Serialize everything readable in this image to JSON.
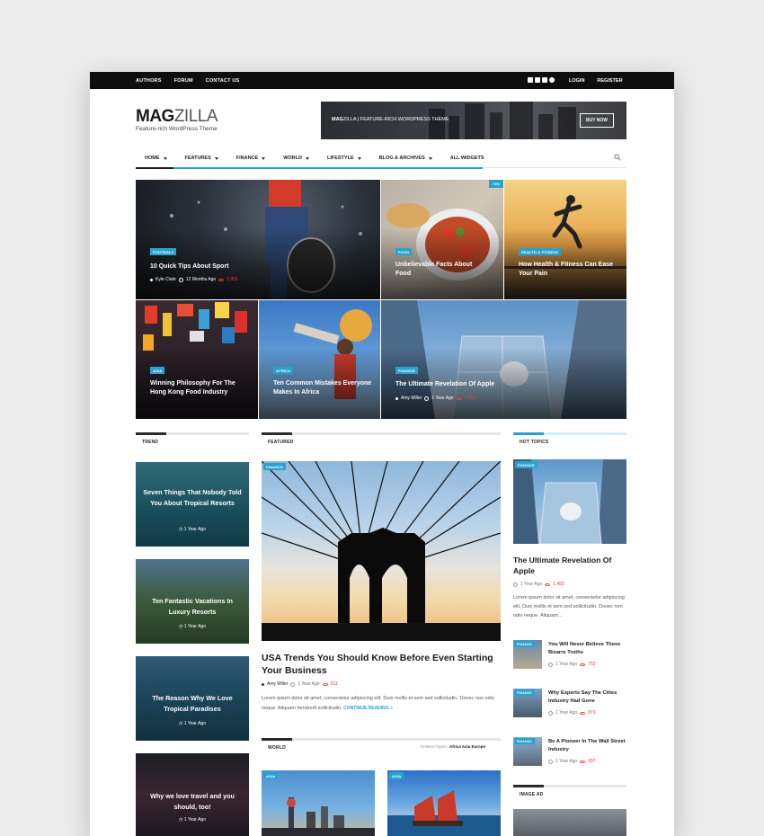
{
  "topbar": {
    "links": [
      "AUTHORS",
      "FORUM",
      "CONTACT US"
    ],
    "social_icons": [
      "rss-icon",
      "facebook-icon",
      "twitter-icon",
      "pinterest-icon"
    ],
    "login": "LOGIN",
    "register": "REGISTER"
  },
  "logo": {
    "mag": "MAG",
    "zilla": "ZILLA",
    "tagline": "Feature-rich WordPress Theme"
  },
  "banner": {
    "brand": "MAG",
    "brand2": "ZILLA",
    "text": " | FEATURE-RICH WORDPRESS THEME",
    "button": "BUY NOW"
  },
  "nav": {
    "items": [
      {
        "label": "HOME",
        "dropdown": true
      },
      {
        "label": "FEATURES",
        "dropdown": true
      },
      {
        "label": "FINANCE",
        "dropdown": true
      },
      {
        "label": "WORLD",
        "dropdown": true
      },
      {
        "label": "LIFESTYLE",
        "dropdown": true
      },
      {
        "label": "BLOG & ARCHIVES",
        "dropdown": true
      },
      {
        "label": "ALL WIDGETS",
        "dropdown": false
      }
    ]
  },
  "hero": {
    "t1": {
      "badge": "FOOTBALL",
      "title": "10 Quick Tips About Sport",
      "author": "Kyle Clark",
      "time": "12 Months Ago",
      "views": "1,001"
    },
    "t2": {
      "badge": "FOOD",
      "title": "Unbelievable Facts About Food",
      "pct": "74%"
    },
    "t3": {
      "badge": "HEALTH & FITNESS",
      "title": "How Health & Fitness Can Ease Your Pain"
    },
    "t4": {
      "badge": "ASIA",
      "title": "Winning Philosophy For The Hong Kong Food Industry"
    },
    "t5": {
      "badge": "AFRICA",
      "title": "Ten Common Mistakes Everyone Makes In Africa"
    },
    "t6": {
      "badge": "FINANCE",
      "title": "The Ultimate Revelation Of Apple",
      "author": "Amy Miller",
      "time": "1 Year Ago",
      "views": "1,493"
    }
  },
  "sections": {
    "trend": "TREND",
    "featured": "FEATURED",
    "hot": "HOT TOPICS",
    "world": "WORLD",
    "image_ad": "IMAGE AD"
  },
  "trend": [
    {
      "title": "Seven Things That Nobody Told You About Tropical Resorts",
      "time": "1 Year Ago"
    },
    {
      "title": "Ten Fantastic Vacations In Luxury Resorts",
      "time": "1 Year Ago"
    },
    {
      "title": "The Reason Why We Love Tropical Paradises",
      "time": "1 Year Ago"
    },
    {
      "title": "Why we love travel and you should, too!",
      "time": "1 Year Ago"
    }
  ],
  "featured": {
    "badge": "FINANCE",
    "title": "USA Trends You Should Know Before Even Starting Your Business",
    "author": "Amy Miller",
    "time": "1 Year Ago",
    "views": "311",
    "excerpt": "Lorem ipsum dolor sit amet, consectetur adipiscing elit. Duis mollis et sem sed sollicitudin. Donec non odio neque. Aliquam hendrerit sollicitudin.",
    "more": "CONTINUE READING »"
  },
  "world": {
    "related_label": "Related Topics:",
    "related": "Africa Asia Europe",
    "badges": [
      "ASIA",
      "ASIA"
    ]
  },
  "hot": {
    "badge": "FINANCE",
    "title": "The Ultimate Revelation Of Apple",
    "time": "1 Year Ago",
    "views": "1,493",
    "excerpt": "Lorem ipsum dolor sit amet, consectetur adipiscing elit. Duis mollis et sem sed sollicitudin. Donec non odio neque. Aliquam...",
    "items": [
      {
        "badge": "FINANCE",
        "title": "You Will Never Believe These Bizarre Truths",
        "time": "1 Year Ago",
        "views": "752"
      },
      {
        "badge": "FINANCE",
        "title": "Why Experts Say The Cities Industry Had Gone",
        "time": "1 Year Ago",
        "views": "971"
      },
      {
        "badge": "FINANCE",
        "title": "Be A Pioneer In The Wall Street Industry",
        "time": "1 Year Ago",
        "views": "357"
      }
    ]
  },
  "colors": {
    "accent": "#2aa2cf",
    "topbar": "#0e0e0e",
    "views": "#e33333"
  }
}
